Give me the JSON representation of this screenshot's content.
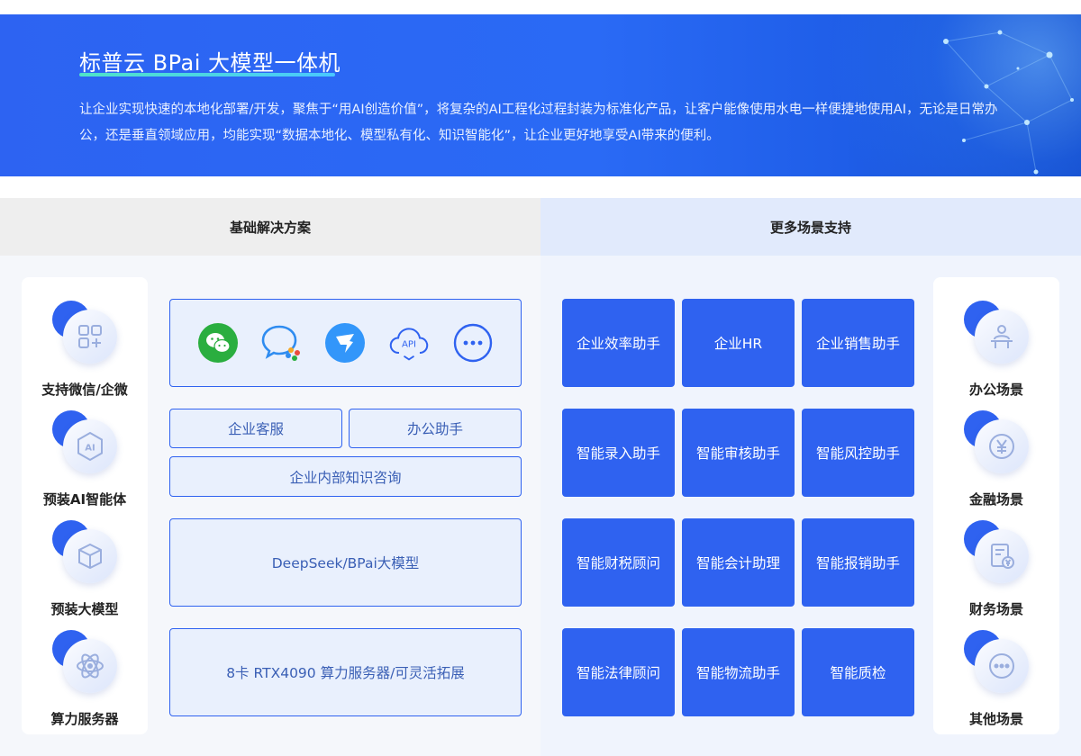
{
  "banner": {
    "title": "标普云 BPai 大模型一体机",
    "description": "让企业实现快速的本地化部署/开发，聚焦于“用AI创造价值”，将复杂的AI工程化过程封装为标准化产品，让客户能像使用水电一样便捷地使用AI，无论是日常办公，还是垂直领域应用，均能实现“数据本地化、模型私有化、知识智能化”，让企业更好地享受AI带来的便利。"
  },
  "left_panel": {
    "header": "基础解决方案",
    "features": [
      {
        "label": "支持微信/企微",
        "icon": "apps-icon"
      },
      {
        "label": "预装AI智能体",
        "icon": "ai-icon"
      },
      {
        "label": "预装大模型",
        "icon": "cube-icon"
      },
      {
        "label": "算力服务器",
        "icon": "atom-icon"
      }
    ],
    "apps": [
      {
        "name": "wechat-icon"
      },
      {
        "name": "wecom-icon"
      },
      {
        "name": "dingtalk-icon"
      },
      {
        "name": "api-cloud-icon",
        "label": "API"
      },
      {
        "name": "more-icon"
      }
    ],
    "boxes": {
      "customer_service": "企业客服",
      "office_assistant": "办公助手",
      "knowledge": "企业内部知识咨询",
      "model": "DeepSeek/BPai大模型",
      "server": "8卡 RTX4090 算力服务器/可灵活拓展"
    }
  },
  "right_panel": {
    "header": "更多场景支持",
    "tiles": [
      [
        "企业效率助手",
        "企业HR",
        "企业销售助手"
      ],
      [
        "智能录入助手",
        "智能审核助手",
        "智能风控助手"
      ],
      [
        "智能财税顾问",
        "智能会计助理",
        "智能报销助手"
      ],
      [
        "智能法律顾问",
        "智能物流助手",
        "智能质检"
      ]
    ],
    "scenes": [
      {
        "label": "办公场景",
        "icon": "office-icon"
      },
      {
        "label": "金融场景",
        "icon": "yuan-icon"
      },
      {
        "label": "财务场景",
        "icon": "finance-doc-icon"
      },
      {
        "label": "其他场景",
        "icon": "more-icon"
      }
    ]
  },
  "colors": {
    "primary": "#2f62f0",
    "banner": "#2d63f2",
    "box_bg": "#e9f0fd",
    "accent_line": "#4fe3c8"
  }
}
